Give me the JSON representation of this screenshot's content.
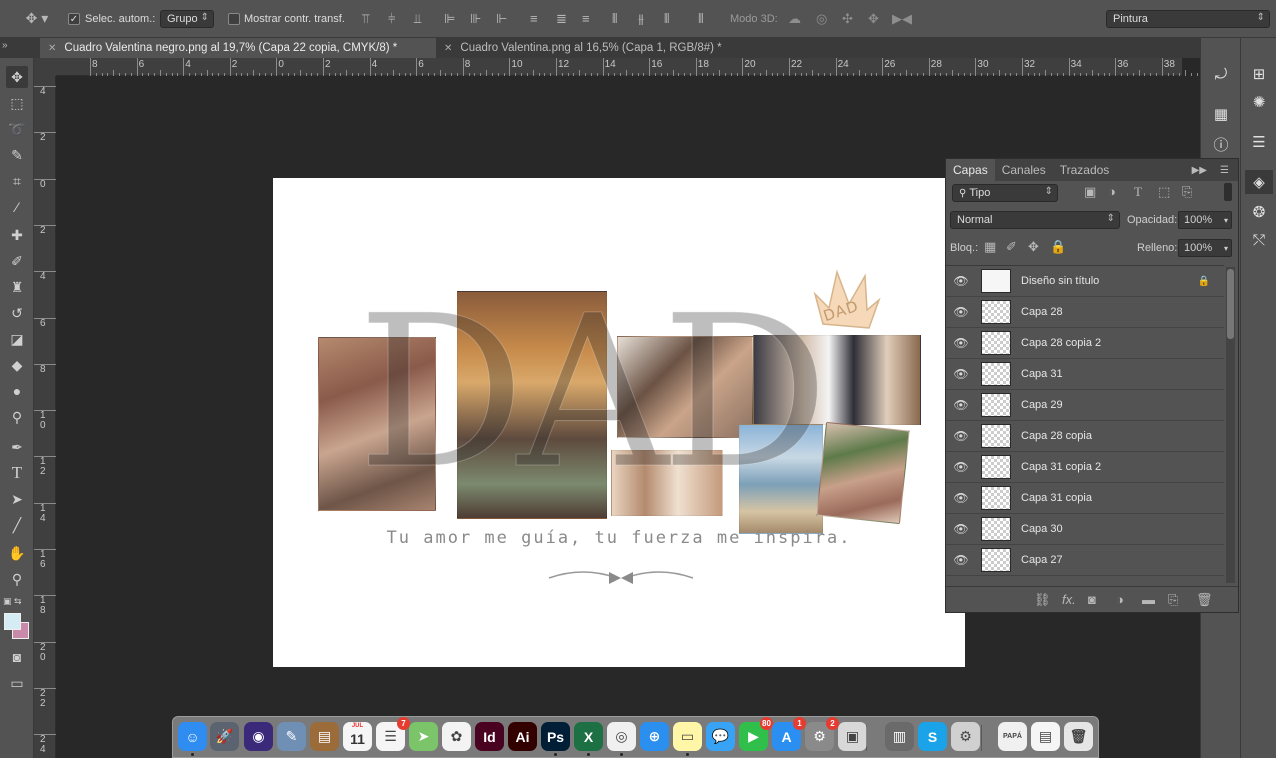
{
  "options_bar": {
    "auto_select_label": "Selec. autom.:",
    "auto_select_value": "Grupo",
    "show_transform_label": "Mostrar contr. transf.",
    "mode3d_label": "Modo 3D:",
    "workspace_value": "Pintura"
  },
  "tabs": [
    {
      "label": "Cuadro Valentina negro.png al 19,7% (Capa 22 copia, CMYK/8) *"
    },
    {
      "label": "Cuadro Valentina.png al 16,5% (Capa 1, RGB/8#) *"
    }
  ],
  "ruler": {
    "h_labels": [
      "8",
      "6",
      "4",
      "2",
      "0",
      "2",
      "4",
      "6",
      "8",
      "10",
      "12",
      "14",
      "16",
      "18",
      "20",
      "22",
      "24",
      "26",
      "28",
      "30",
      "32",
      "34",
      "36",
      "38"
    ],
    "v_labels": [
      "4",
      "2",
      "0",
      "2",
      "4",
      "6",
      "8",
      "1\n0",
      "1\n2",
      "1\n4",
      "1\n6",
      "1\n8",
      "2\n0",
      "2\n2",
      "2\n4"
    ]
  },
  "document": {
    "big_text": "DAD",
    "crown_text": "DAD",
    "tagline": "Tu amor me guía, tu fuerza me inspira."
  },
  "layers_panel": {
    "tabs": [
      "Capas",
      "Canales",
      "Trazados"
    ],
    "filter_value": "Tipo",
    "blend_mode": "Normal",
    "opacity_label": "Opacidad:",
    "opacity_value": "100%",
    "lock_label": "Bloq.:",
    "fill_label": "Relleno:",
    "fill_value": "100%",
    "layers": [
      {
        "name": "Diseño sin título",
        "locked": true
      },
      {
        "name": "Capa 28"
      },
      {
        "name": "Capa 28 copia 2"
      },
      {
        "name": "Capa 31"
      },
      {
        "name": "Capa 29"
      },
      {
        "name": "Capa 28 copia"
      },
      {
        "name": "Capa 31 copia 2"
      },
      {
        "name": "Capa 31 copia"
      },
      {
        "name": "Capa 30"
      },
      {
        "name": "Capa 27"
      }
    ]
  },
  "dock": {
    "calendar_month": "JUL",
    "calendar_day": "11",
    "apps": [
      {
        "name": "Finder",
        "color": "#2f8cf0",
        "glyph": "☺"
      },
      {
        "name": "Launchpad",
        "color": "#5b6270",
        "glyph": "🚀"
      },
      {
        "name": "Siri",
        "color": "#3b2a7a",
        "glyph": "◉"
      },
      {
        "name": "Preview",
        "color": "#6f8fb5",
        "glyph": "✎"
      },
      {
        "name": "Notebook",
        "color": "#9b6b3a",
        "glyph": "▤"
      },
      {
        "name": "Calendar",
        "color": "#f5f5f5",
        "glyph": "11"
      },
      {
        "name": "Reminders",
        "color": "#f5f5f5",
        "glyph": "☰",
        "badge": "7"
      },
      {
        "name": "Maps",
        "color": "#7bc46a",
        "glyph": "➤"
      },
      {
        "name": "Photos",
        "color": "#f3f3f3",
        "glyph": "✿"
      },
      {
        "name": "InDesign",
        "color": "#49021f",
        "glyph": "Id"
      },
      {
        "name": "Illustrator",
        "color": "#330000",
        "glyph": "Ai"
      },
      {
        "name": "Photoshop",
        "color": "#001e36",
        "glyph": "Ps"
      },
      {
        "name": "Excel",
        "color": "#1d7044",
        "glyph": "X"
      },
      {
        "name": "Chrome",
        "color": "#f0f0f0",
        "glyph": "◎"
      },
      {
        "name": "Safari",
        "color": "#2b8ff0",
        "glyph": "⊕"
      },
      {
        "name": "Notes",
        "color": "#fff6a8",
        "glyph": "▭"
      },
      {
        "name": "Messages",
        "color": "#38a3f5",
        "glyph": "💬"
      },
      {
        "name": "FaceTime",
        "color": "#2fbf4a",
        "glyph": "▶",
        "badge": "80"
      },
      {
        "name": "App Store",
        "color": "#2a8ff0",
        "glyph": "A",
        "badge": "1"
      },
      {
        "name": "System Preferences",
        "color": "#8a8a8a",
        "glyph": "⚙",
        "badge": "2"
      },
      {
        "name": "Image Capture",
        "color": "#d8d8d8",
        "glyph": "▣"
      },
      {
        "name": "Archive",
        "color": "#6a6a6a",
        "glyph": "▥"
      },
      {
        "name": "Skype",
        "color": "#1aa3e8",
        "glyph": "S"
      },
      {
        "name": "Settings Gear",
        "color": "#d0d0d0",
        "glyph": "⚙"
      },
      {
        "name": "Document Papa",
        "color": "#f0f0f0",
        "glyph": "PAPÁ"
      },
      {
        "name": "Documents",
        "color": "#f5f5f5",
        "glyph": "▤"
      },
      {
        "name": "Trash",
        "color": "#e6e6e6",
        "glyph": "🗑"
      }
    ]
  }
}
